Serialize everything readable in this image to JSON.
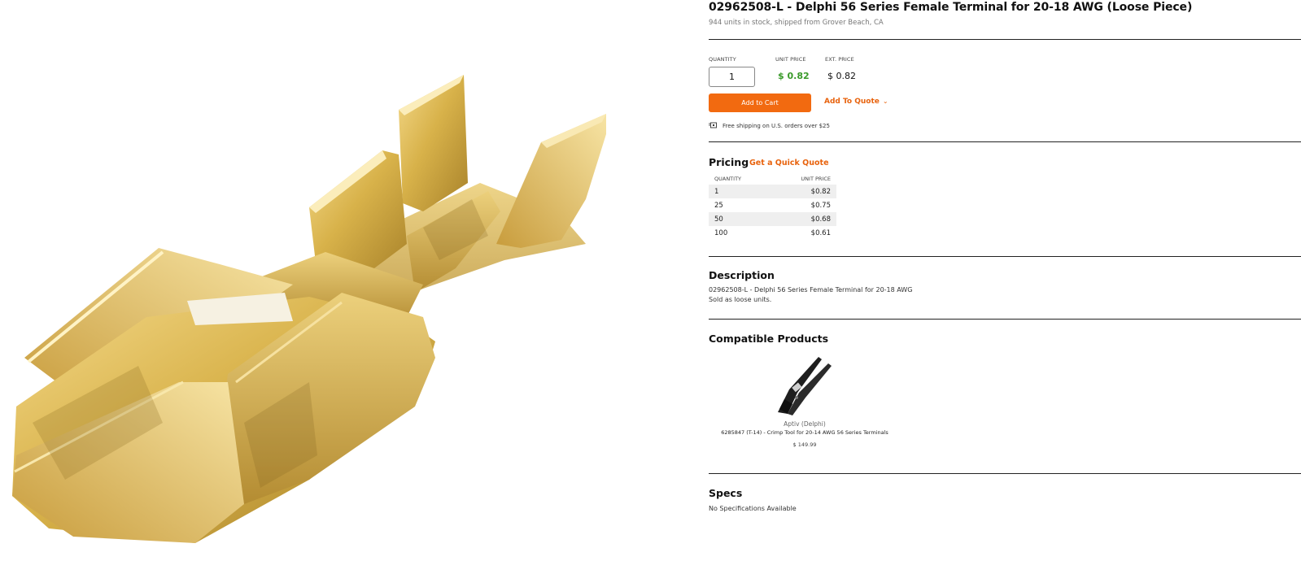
{
  "product": {
    "title": "02962508-L - Delphi 56 Series Female Terminal for 20-18 AWG (Loose Piece)",
    "stock_text": "944 units in stock, shipped from Grover Beach, CA",
    "image_icon": "brass-female-terminal-photo"
  },
  "purchase": {
    "quantity_label": "QUANTITY",
    "quantity_value": "1",
    "unit_price_label": "UNIT PRICE",
    "unit_price": "$ 0.82",
    "ext_price_label": "EXT. PRICE",
    "ext_price": "$ 0.82",
    "add_to_cart": "Add to Cart",
    "add_to_quote": "Add To Quote",
    "shipping_note": "Free shipping on U.S. orders over $25",
    "shipping_icon": "truck-icon"
  },
  "pricing": {
    "title": "Pricing",
    "quick_quote": "Get a Quick Quote",
    "col_quantity": "QUANTITY",
    "col_unit_price": "UNIT PRICE",
    "rows": [
      {
        "qty": "1",
        "price": "$0.82"
      },
      {
        "qty": "25",
        "price": "$0.75"
      },
      {
        "qty": "50",
        "price": "$0.68"
      },
      {
        "qty": "100",
        "price": "$0.61"
      }
    ]
  },
  "description": {
    "title": "Description",
    "line1": "02962508-L - Delphi 56 Series Female Terminal for 20-18 AWG",
    "line2": "Sold as loose units."
  },
  "compatible": {
    "title": "Compatible Products",
    "items": [
      {
        "brand": "Aptiv (Delphi)",
        "name": "6285847 (T-14) - Crimp Tool for 20-14 AWG 56 Series Terminals",
        "price": "$ 149.99",
        "icon": "crimp-tool-icon"
      }
    ]
  },
  "specs": {
    "title": "Specs",
    "text": "No Specifications Available"
  },
  "colors": {
    "accent": "#f26a10",
    "price_green": "#3a9a2a",
    "brass": "#d8b24a"
  }
}
